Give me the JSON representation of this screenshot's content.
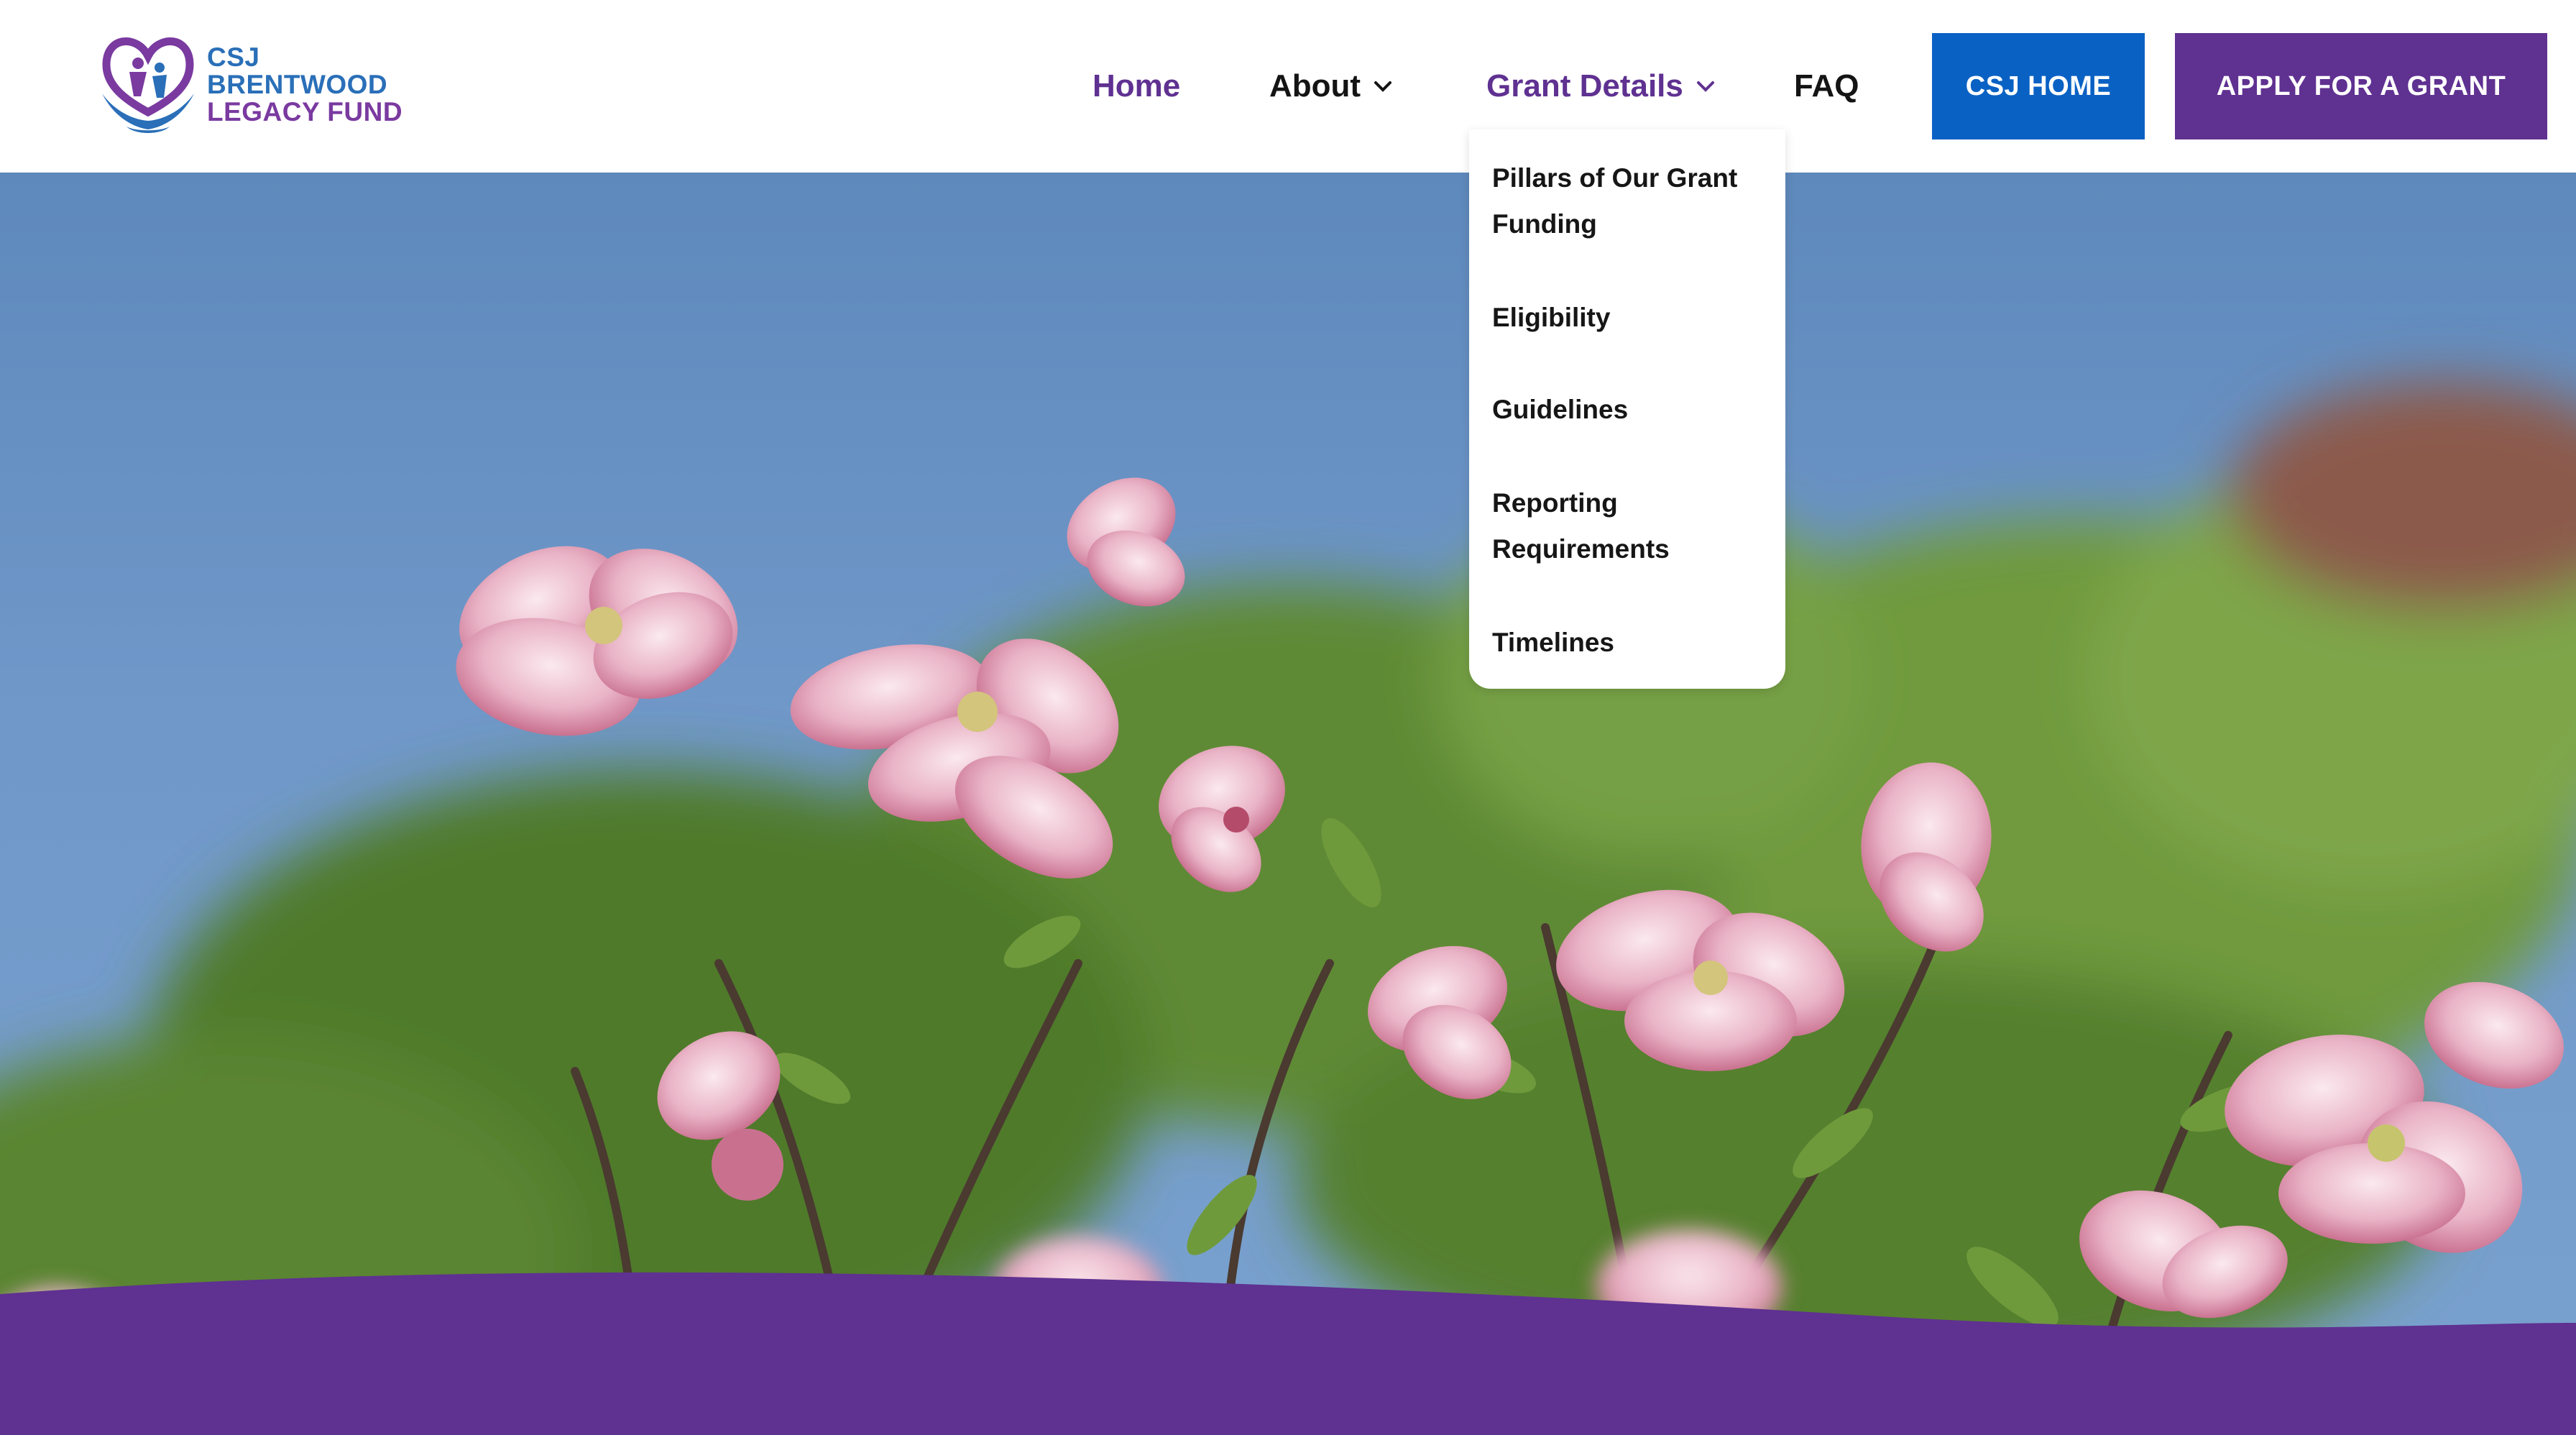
{
  "logo": {
    "line1": "CSJ",
    "line2": "BRENTWOOD",
    "line3": "LEGACY FUND",
    "icon": "heart-hands-icon"
  },
  "nav": {
    "home": "Home",
    "about": "About",
    "grant_details": "Grant Details",
    "faq": "FAQ"
  },
  "buttons": {
    "csj_home": "CSJ HOME",
    "apply": "APPLY FOR A GRANT"
  },
  "dropdown": {
    "items": [
      {
        "label": "Pillars of Our Grant Funding"
      },
      {
        "label": "Eligibility"
      },
      {
        "label": "Guidelines"
      },
      {
        "label": "Reporting Requirements"
      },
      {
        "label": "Timelines"
      }
    ]
  },
  "colors": {
    "brand_purple": "#5f3191",
    "brand_blue": "#0a61c4",
    "logo_blue": "#2a6fb8"
  },
  "hero": {
    "image": "pink-dogwood-flowers-photo"
  }
}
